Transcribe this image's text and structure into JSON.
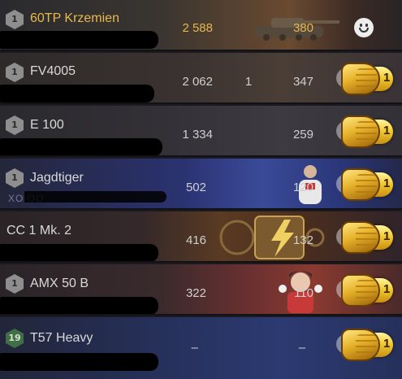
{
  "players": [
    {
      "tier": "1",
      "tier_style": "gray",
      "vehicle": "60TP Krzemien",
      "name_style": "gold",
      "damage": "2 588",
      "kills": "",
      "experience": "380",
      "reaction": "smiley",
      "reaction_count": ""
    },
    {
      "tier": "1",
      "tier_style": "gray",
      "vehicle": "FV4005",
      "name_style": "normal",
      "damage": "2 062",
      "kills": "1",
      "experience": "347",
      "reaction": "golden-fist",
      "reaction_count": "1"
    },
    {
      "tier": "1",
      "tier_style": "gray",
      "vehicle": "E 100",
      "name_style": "normal",
      "damage": "1 334",
      "kills": "",
      "experience": "259",
      "reaction": "golden-fist",
      "reaction_count": "1"
    },
    {
      "tier": "1",
      "tier_style": "gray",
      "vehicle": "Jagdtiger",
      "name_style": "normal",
      "damage": "502",
      "kills": "",
      "experience": "120",
      "reaction": "golden-fist",
      "reaction_count": "1"
    },
    {
      "tier": "",
      "tier_style": "none",
      "vehicle": "CC 1 Mk. 2",
      "name_style": "normal",
      "damage": "416",
      "kills": "",
      "experience": "132",
      "reaction": "golden-fist",
      "reaction_count": "1"
    },
    {
      "tier": "1",
      "tier_style": "gray",
      "vehicle": "AMX 50 B",
      "name_style": "normal",
      "damage": "322",
      "kills": "",
      "experience": "110",
      "reaction": "golden-fist",
      "reaction_count": "1"
    },
    {
      "tier": "19",
      "tier_style": "green",
      "vehicle": "T57 Heavy",
      "name_style": "normal",
      "damage": "–",
      "kills": "",
      "experience": "–",
      "reaction": "golden-fist",
      "reaction_count": "1"
    }
  ],
  "ghost_text": {
    "row4": "XO OO"
  },
  "colors": {
    "gold_text": "#e8b94c",
    "row_dark": "#2a2628",
    "row_blue": "#2c3a6e",
    "tier_green": "#3f6e47",
    "reaction_gold": "#f1cb33"
  },
  "icons": [
    "tier-badge-icon",
    "tank-silhouette-icon",
    "smiley-face-icon",
    "golden-fist-icon"
  ]
}
